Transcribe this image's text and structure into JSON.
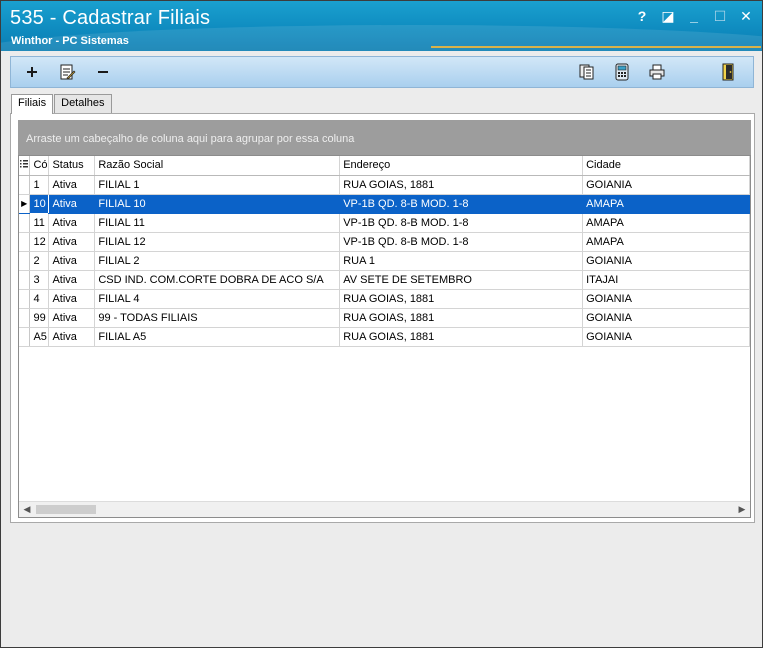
{
  "window": {
    "title": "535 - Cadastrar Filiais",
    "subtitle": "Winthor - PC Sistemas",
    "controls": {
      "help": "?",
      "restore": "◪",
      "minimize": "_",
      "maximize": "☐",
      "close": "✕"
    }
  },
  "toolbar": {
    "left_icons": [
      "plus-icon",
      "edit-document-icon",
      "minus-icon"
    ],
    "right_icons": [
      "copy-documents-icon",
      "calculator-icon",
      "printer-icon",
      "exit-door-icon"
    ]
  },
  "tabs": [
    {
      "label": "Filiais",
      "active": true
    },
    {
      "label": "Detalhes",
      "active": false
    }
  ],
  "grid": {
    "group_hint": "Arraste um cabeçalho de coluna aqui para agrupar por essa coluna",
    "columns": [
      "Có",
      "Status",
      "Razão Social",
      "Endereço",
      "Cidade"
    ],
    "rows": [
      [
        "1",
        "Ativa",
        "FILIAL 1",
        "RUA GOIAS, 1881",
        "GOIANIA"
      ],
      [
        "10",
        "Ativa",
        "FILIAL 10",
        "VP-1B QD. 8-B MOD. 1-8",
        "AMAPA"
      ],
      [
        "11",
        "Ativa",
        "FILIAL 11",
        "VP-1B QD. 8-B MOD. 1-8",
        "AMAPA"
      ],
      [
        "12",
        "Ativa",
        "FILIAL 12",
        "VP-1B QD. 8-B MOD. 1-8",
        "AMAPA"
      ],
      [
        "2",
        "Ativa",
        "FILIAL 2",
        "RUA 1",
        "GOIANIA"
      ],
      [
        "3",
        "Ativa",
        "CSD IND. COM.CORTE DOBRA DE ACO S/A",
        "AV SETE DE SETEMBRO",
        "ITAJAI"
      ],
      [
        "4",
        "Ativa",
        "FILIAL 4",
        "RUA GOIAS, 1881",
        "GOIANIA"
      ],
      [
        "99",
        "Ativa",
        "99 - TODAS FILIAIS",
        "RUA GOIAS, 1881",
        "GOIANIA"
      ],
      [
        "A5",
        "Ativa",
        "FILIAL A5",
        "RUA GOIAS, 1881",
        "GOIANIA"
      ]
    ],
    "selected_row": 1,
    "row_indicator": "▶"
  },
  "colors": {
    "title_bar": "#0f8cc0",
    "selection": "#0b62c8",
    "group_area": "#9d9d9d"
  }
}
